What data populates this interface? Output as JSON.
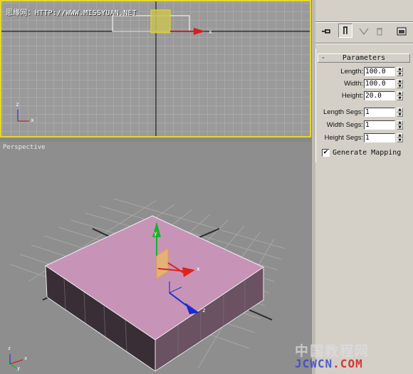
{
  "watermark_top": "思缘网：HTTP://WWW.MISSYUAN.NET",
  "front_view": {
    "axis_z": "z",
    "axis_x": "x"
  },
  "perspective_view": {
    "label": "Perspective",
    "gizmo_y": "y",
    "gizmo_x": "x",
    "gizmo_z": "z",
    "corner_axis_z": "z",
    "corner_axis_x": "x",
    "corner_axis_y": "y"
  },
  "command_panel": {
    "icons": [
      "pin-icon",
      "stack-toggle-icon",
      "funnel-icon",
      "trash-icon",
      "configure-icon"
    ],
    "rollout_title": "Parameters",
    "rollout_toggle": "-",
    "params": [
      {
        "label": "Length:",
        "value": "100.0"
      },
      {
        "label": "Width:",
        "value": "100.0"
      },
      {
        "label": "Height:",
        "value": "20.0"
      }
    ],
    "segs": [
      {
        "label": "Length Segs:",
        "value": "1"
      },
      {
        "label": "Width Segs:",
        "value": "1"
      },
      {
        "label": "Height Segs:",
        "value": "1"
      }
    ],
    "generate_mapping_label": "Generate Mapping",
    "generate_mapping_checked": true,
    "spin_up": "▲",
    "spin_down": "▼",
    "check_mark": "✔"
  },
  "watermark_logo": {
    "cn": "中国教程网",
    "en_prefix": "JCWCN",
    "en_suffix": ".COM"
  },
  "colors": {
    "viewport_active_border": "#e6d829",
    "box_fill": "#c794b8",
    "gizmo_x": "#e0221c",
    "gizmo_y": "#1cb02c",
    "gizmo_z": "#1c2ad0"
  }
}
